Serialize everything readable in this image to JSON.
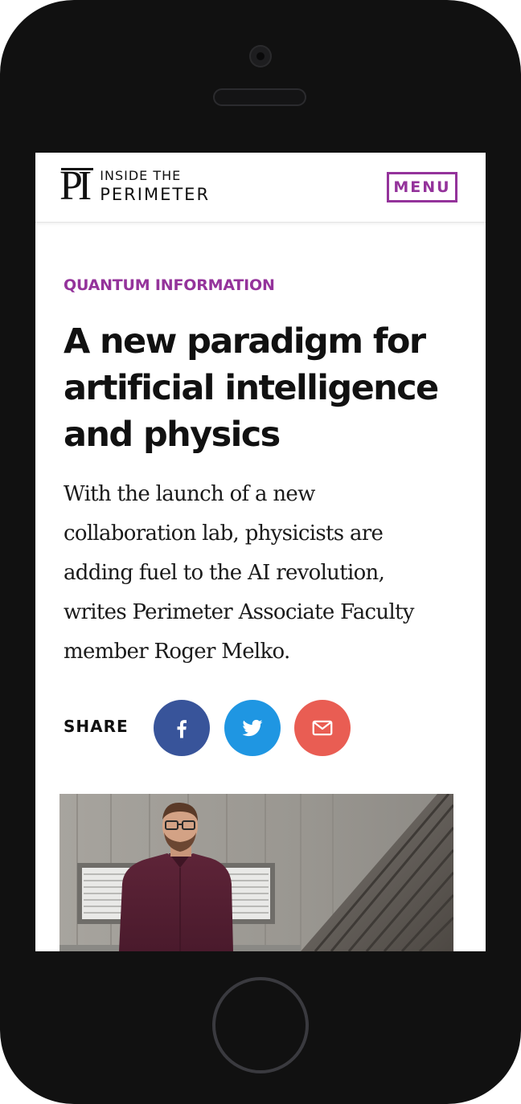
{
  "header": {
    "logo": {
      "mark": "PI",
      "line1": "INSIDE THE",
      "line2": "PERIMETER"
    },
    "menu_label": "MENU"
  },
  "article": {
    "category": "QUANTUM INFORMATION",
    "title_lines": [
      "A new paradigm for",
      "artificial intelligence",
      "and physics"
    ],
    "standfirst_lines": [
      "With the launch of a new",
      "collaboration lab, physicists are",
      "adding fuel to the AI revolution,",
      "writes Perimeter Associate Faculty",
      "member Roger Melko."
    ]
  },
  "share": {
    "label": "SHARE",
    "buttons": [
      {
        "network": "facebook",
        "icon": "facebook-icon",
        "color": "#38549a"
      },
      {
        "network": "twitter",
        "icon": "twitter-icon",
        "color": "#1f96e2"
      },
      {
        "network": "email",
        "icon": "mail-icon",
        "color": "#e95d53"
      }
    ]
  },
  "colors": {
    "accent": "#94339b",
    "device_frame": "#111111",
    "text": "#111111"
  }
}
